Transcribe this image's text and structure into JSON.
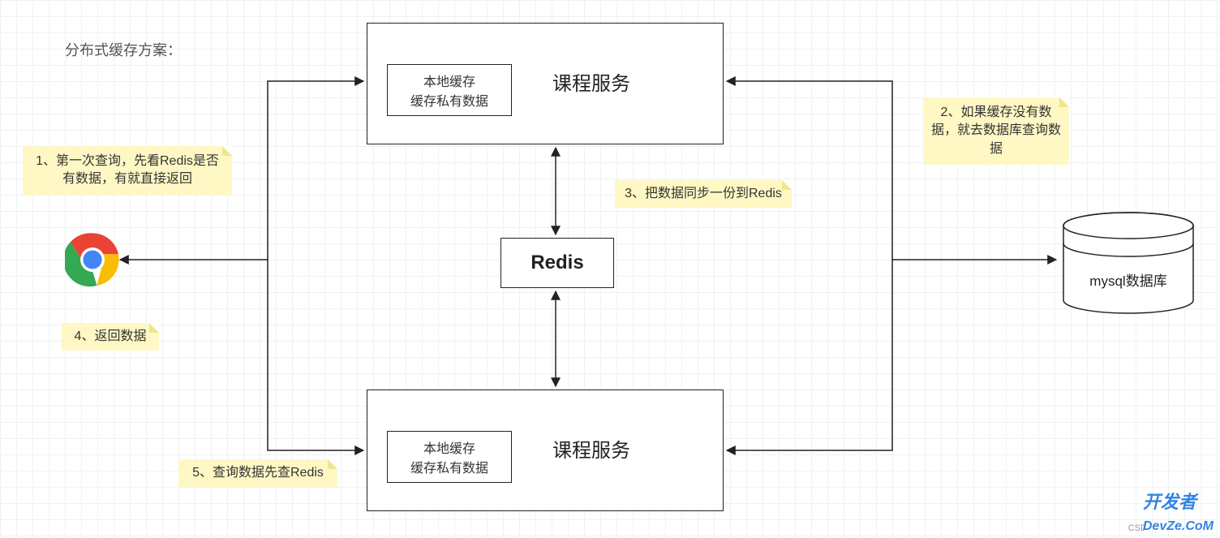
{
  "title": "分布式缓存方案：",
  "service_top": {
    "title": "课程服务",
    "inner_line1": "本地缓存",
    "inner_line2": "缓存私有数据"
  },
  "service_bottom": {
    "title": "课程服务",
    "inner_line1": "本地缓存",
    "inner_line2": "缓存私有数据"
  },
  "redis_label": "Redis",
  "db_label": "mysql数据库",
  "notes": {
    "n1": "1、第一次查询，先看Redis是否有数据，有就直接返回",
    "n2": "2、如果缓存没有数据，就去数据库查询数据",
    "n3": "3、把数据同步一份到Redis",
    "n4": "4、返回数据",
    "n5": "5、查询数据先查Redis"
  },
  "watermark": "开发者",
  "watermark2": "DevZe.CoM",
  "watermark_csdn": "CSD"
}
